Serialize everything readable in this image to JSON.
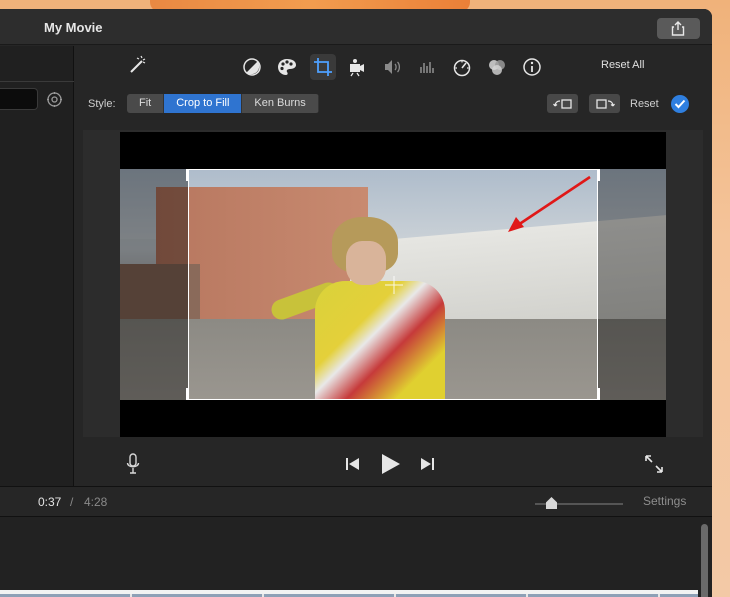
{
  "window": {
    "title": "My Movie"
  },
  "toolbar": {
    "tools": [
      "magic-wand",
      "color-balance",
      "color-correction",
      "crop",
      "stabilization",
      "volume",
      "noise-reduction",
      "speed",
      "clip-filter",
      "info"
    ],
    "reset_all_label": "Reset All"
  },
  "stylebar": {
    "label": "Style:",
    "options": [
      "Fit",
      "Crop to Fill",
      "Ken Burns"
    ],
    "selected": "Crop to Fill",
    "reset_label": "Reset"
  },
  "timebar": {
    "current": "0:37",
    "separator": "/",
    "total": "4:28",
    "settings_label": "Settings"
  },
  "colors": {
    "accent": "#2f74d0",
    "arrow": "#e01818"
  }
}
